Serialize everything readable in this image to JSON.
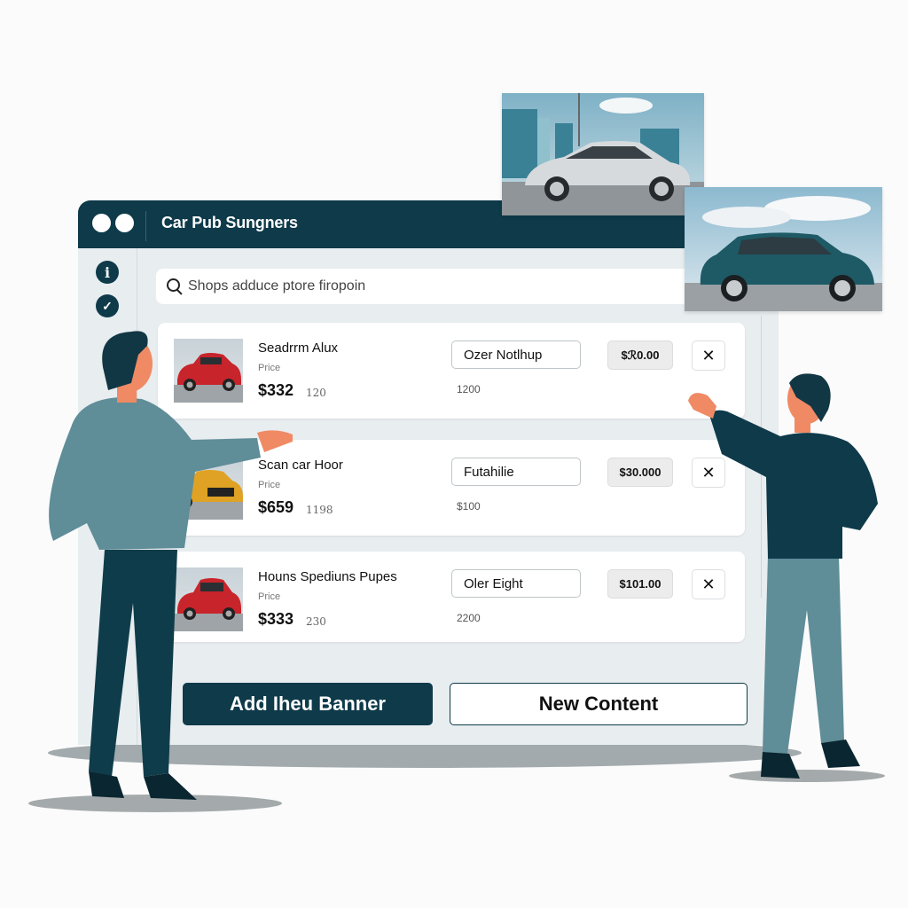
{
  "window": {
    "title": "Car Pub Sungners",
    "sidebar_icons": [
      "info-icon",
      "check-icon"
    ],
    "info_glyph": "i",
    "check_glyph": "✓"
  },
  "search": {
    "icon": "search-icon",
    "value": "Shops adduce ptore firopoin"
  },
  "listings": [
    {
      "name": "Seadrrm Alux",
      "price_label": "Price",
      "price": "$332",
      "qty": "120",
      "option": "Ozer Notlhup",
      "sub_value": "1200",
      "amount": "$ℛ0.00",
      "remove_glyph": "✕",
      "car_color": "#c8242b"
    },
    {
      "name": "Scan car Hoor",
      "price_label": "Price",
      "price": "$659",
      "qty": "1198",
      "option": "Futahilie",
      "sub_value": "$100",
      "amount": "$30.000",
      "remove_glyph": "✕",
      "car_color": "#e0a224"
    },
    {
      "name": "Houns Spediuns Pupes",
      "price_label": "Price",
      "price": "$333",
      "qty": "230",
      "option": "Oler Eight",
      "sub_value": "2200",
      "amount": "$101.00",
      "remove_glyph": "✕",
      "car_color": "#c8242b"
    }
  ],
  "actions": {
    "primary_label": "Add Iheu Banner",
    "secondary_label": "New Content"
  },
  "photos": [
    {
      "subject": "silver-sedan",
      "car_color": "#d6dadd"
    },
    {
      "subject": "teal-suv",
      "car_color": "#1d5a66"
    }
  ],
  "colors": {
    "brand_dark": "#0e3a4a",
    "window_bg": "#e8edf0",
    "shirt_left": "#5f8d98",
    "pants_left": "#0f3c4a",
    "skin": "#f08a64"
  }
}
